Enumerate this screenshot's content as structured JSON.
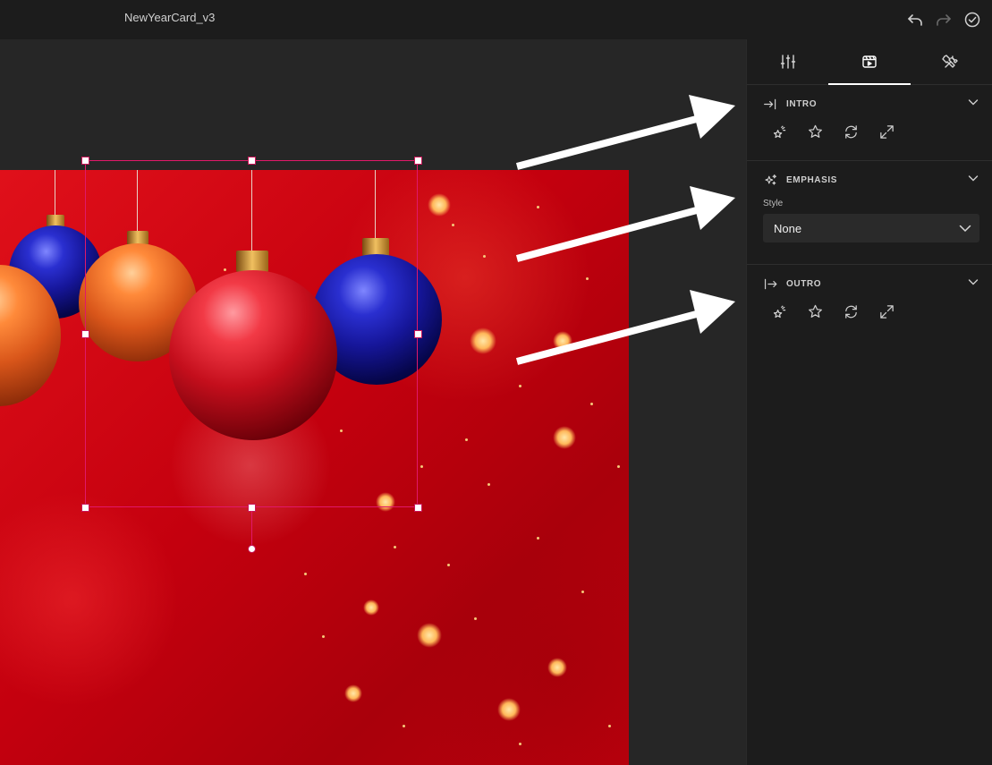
{
  "app": {
    "document_title": "NewYearCard_v3"
  },
  "toolbar": {
    "icons": [
      "undo-icon",
      "redo-icon",
      "done-check-icon"
    ]
  },
  "panel": {
    "tabs": [
      {
        "icon": "adjust-sliders-icon",
        "active": false
      },
      {
        "icon": "animation-icon",
        "active": true
      },
      {
        "icon": "tools-icon",
        "active": false
      }
    ],
    "sections": {
      "intro": {
        "title": "INTRO",
        "icon": "intro-arrow-icon",
        "effects": [
          "sparkle-star-icon",
          "star-icon",
          "loop-icon",
          "expand-icon"
        ]
      },
      "emphasis": {
        "title": "EMPHASIS",
        "icon": "sparkles-icon",
        "style_label": "Style",
        "style_value": "None"
      },
      "outro": {
        "title": "OUTRO",
        "icon": "outro-arrow-icon",
        "effects": [
          "sparkle-star-icon",
          "star-icon",
          "loop-icon",
          "expand-icon"
        ]
      }
    }
  },
  "colors": {
    "selection": "#e0186a",
    "panel_bg": "#1c1c1c",
    "canvas_bg": "#262626",
    "artboard_red": "#d0000f"
  }
}
